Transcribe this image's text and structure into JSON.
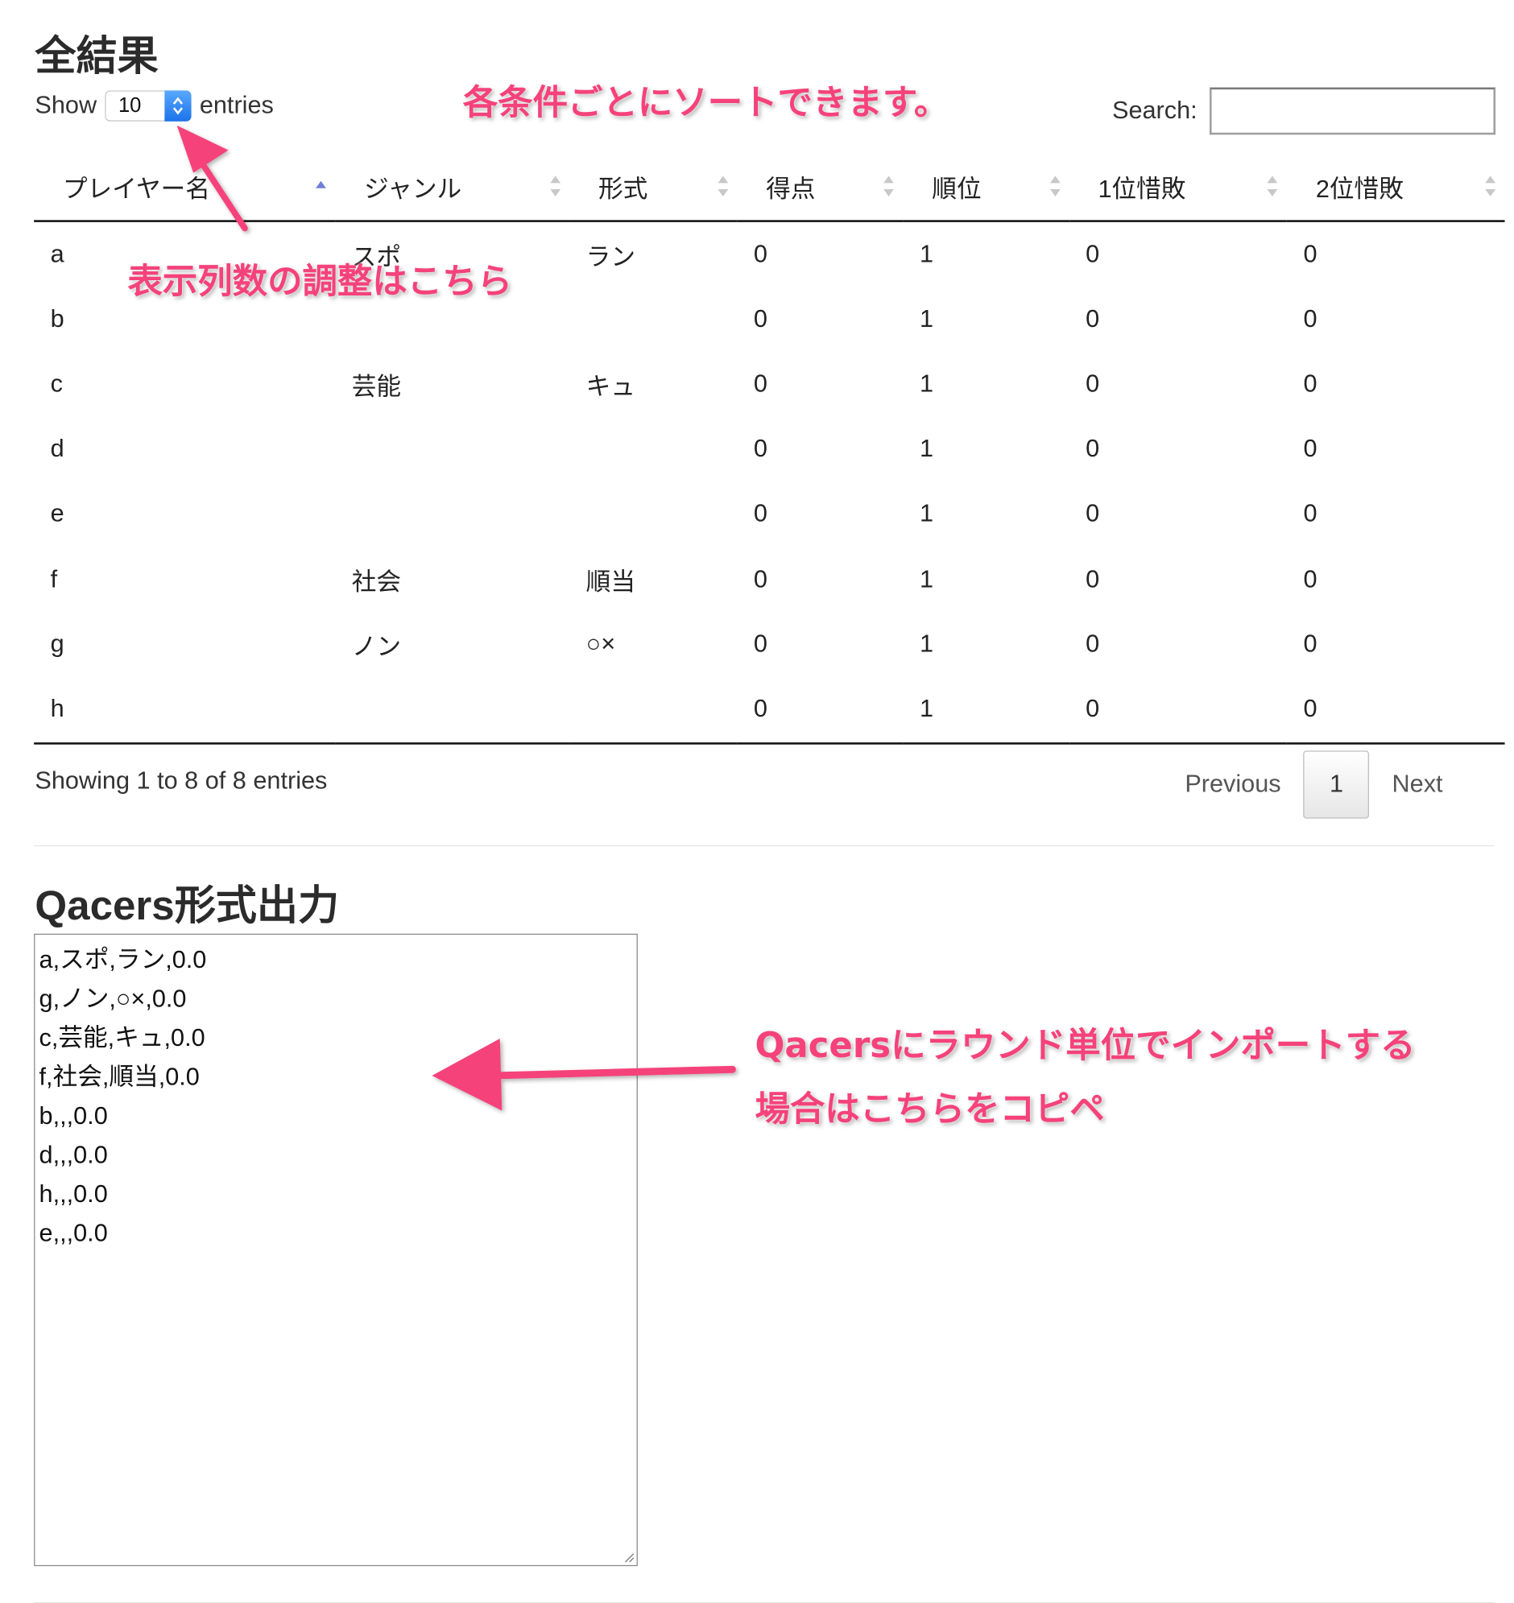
{
  "page": {
    "title": "全結果",
    "output_heading": "Qacers形式出力"
  },
  "length_control": {
    "prefix": "Show",
    "value": "10",
    "suffix": "entries"
  },
  "search": {
    "label": "Search:",
    "value": ""
  },
  "table": {
    "columns": [
      {
        "label": "プレイヤー名",
        "sort": "asc"
      },
      {
        "label": "ジャンル",
        "sort": "none"
      },
      {
        "label": "形式",
        "sort": "none"
      },
      {
        "label": "得点",
        "sort": "none"
      },
      {
        "label": "順位",
        "sort": "none"
      },
      {
        "label": "1位惜敗",
        "sort": "none"
      },
      {
        "label": "2位惜敗",
        "sort": "none"
      }
    ],
    "rows": [
      [
        "a",
        "スポ",
        "ラン",
        "0",
        "1",
        "0",
        "0"
      ],
      [
        "b",
        "",
        "",
        "0",
        "1",
        "0",
        "0"
      ],
      [
        "c",
        "芸能",
        "キュ",
        "0",
        "1",
        "0",
        "0"
      ],
      [
        "d",
        "",
        "",
        "0",
        "1",
        "0",
        "0"
      ],
      [
        "e",
        "",
        "",
        "0",
        "1",
        "0",
        "0"
      ],
      [
        "f",
        "社会",
        "順当",
        "0",
        "1",
        "0",
        "0"
      ],
      [
        "g",
        "ノン",
        "○×",
        "0",
        "1",
        "0",
        "0"
      ],
      [
        "h",
        "",
        "",
        "0",
        "1",
        "0",
        "0"
      ]
    ]
  },
  "info_text": "Showing 1 to 8 of 8 entries",
  "pagination": {
    "previous": "Previous",
    "current": "1",
    "next": "Next"
  },
  "output_lines": [
    "a,スポ,ラン,0.0",
    "g,ノン,○×,0.0",
    "c,芸能,キュ,0.0",
    "f,社会,順当,0.0",
    "b,,,0.0",
    "d,,,0.0",
    "h,,,0.0",
    "e,,,0.0"
  ],
  "annotations": {
    "sort_note": "各条件ごとにソートできます。",
    "length_note": "表示列数の調整はこちら",
    "copy_note_line1": "Qacersにラウンド単位でインポートする",
    "copy_note_line2": "場合はこちらをコピペ",
    "color": "#f5427a"
  },
  "colors": {
    "select_accent": "#1a73e8",
    "sort_active": "#6f7fd6",
    "sort_inactive": "#c8c8c8"
  }
}
